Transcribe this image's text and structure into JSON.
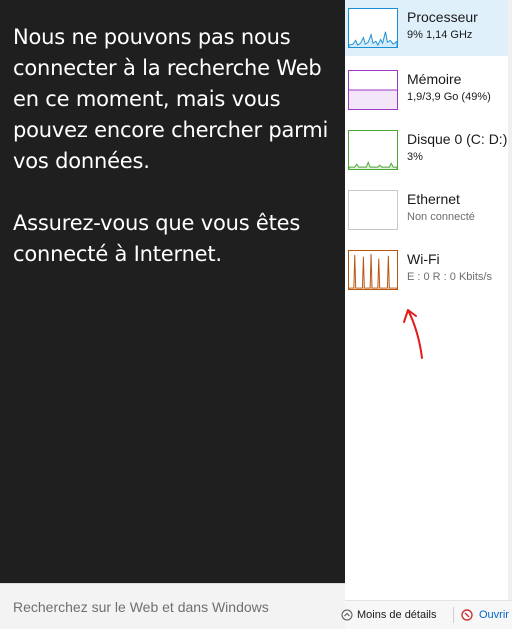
{
  "flyout": {
    "message_line1": "Nous ne pouvons pas nous connecter à la recherche Web en ce moment, mais vous pouvez encore chercher parmi vos données.",
    "message_line2": "Assurez-vous que vous êtes connecté à Internet.",
    "search_placeholder": "Recherchez sur le Web et dans Windows"
  },
  "perf": {
    "items": [
      {
        "name": "Processeur",
        "value": "9% 1,14 GHz",
        "color": "#1a8fd6",
        "selected": true
      },
      {
        "name": "Mémoire",
        "value": "1,9/3,9 Go (49%)",
        "color": "#9b37c9",
        "selected": false
      },
      {
        "name": "Disque 0 (C: D:)",
        "value": "3%",
        "color": "#4da535",
        "selected": false
      },
      {
        "name": "Ethernet",
        "value": "Non connecté",
        "color": "#c8c8c8",
        "selected": false
      },
      {
        "name": "Wi-Fi",
        "value": "E : 0 R : 0 Kbits/s",
        "color": "#b8560e",
        "selected": false
      }
    ]
  },
  "bottom": {
    "less_details": "Moins de détails",
    "open": "Ouvrir"
  },
  "annotation_color": "#e01c1c"
}
